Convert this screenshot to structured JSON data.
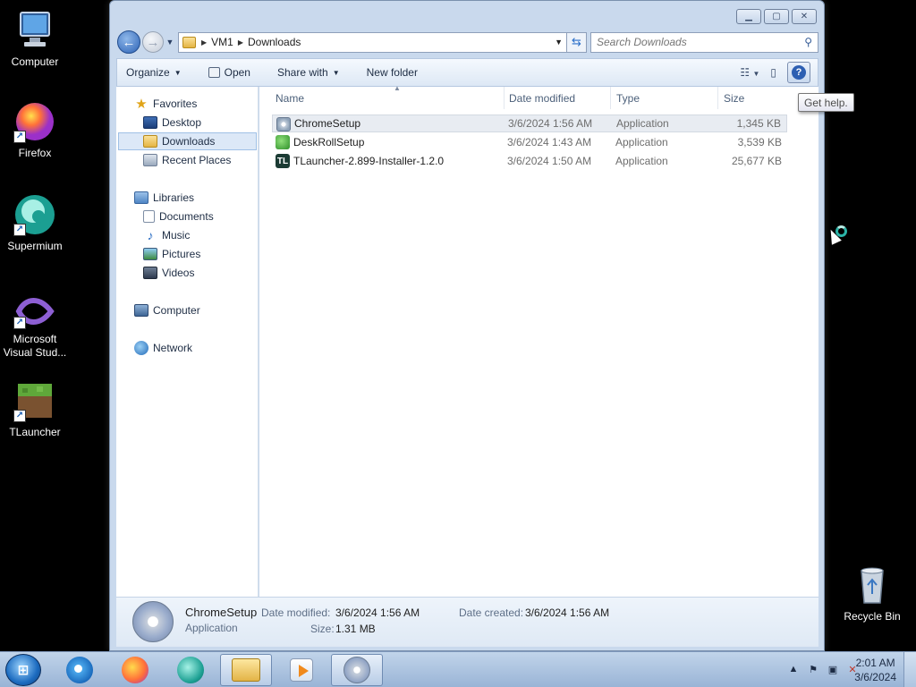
{
  "desktop": {
    "icons": [
      {
        "label": "Computer"
      },
      {
        "label": "Firefox"
      },
      {
        "label": "Supermium"
      },
      {
        "label": "Microsoft Visual Stud..."
      },
      {
        "label": "TLauncher"
      },
      {
        "label": "Recycle Bin"
      }
    ]
  },
  "window": {
    "address": {
      "crumbs": [
        "VM1",
        "Downloads"
      ]
    },
    "search": {
      "placeholder": "Search Downloads"
    },
    "toolbar": {
      "organize": "Organize",
      "open": "Open",
      "share_with": "Share with",
      "new_folder": "New folder"
    },
    "tooltip": "Get help.",
    "nav": {
      "favorites": "Favorites",
      "desktop": "Desktop",
      "downloads": "Downloads",
      "recent_places": "Recent Places",
      "libraries": "Libraries",
      "documents": "Documents",
      "music": "Music",
      "pictures": "Pictures",
      "videos": "Videos",
      "computer": "Computer",
      "network": "Network"
    },
    "columns": {
      "name": "Name",
      "date_modified": "Date modified",
      "type": "Type",
      "size": "Size"
    },
    "files": [
      {
        "name": "ChromeSetup",
        "date": "3/6/2024 1:56 AM",
        "type": "Application",
        "size": "1,345 KB"
      },
      {
        "name": "DeskRollSetup",
        "date": "3/6/2024 1:43 AM",
        "type": "Application",
        "size": "3,539 KB"
      },
      {
        "name": "TLauncher-2.899-Installer-1.2.0",
        "date": "3/6/2024 1:50 AM",
        "type": "Application",
        "size": "25,677 KB"
      }
    ],
    "details": {
      "name": "ChromeSetup",
      "type": "Application",
      "date_modified_label": "Date modified:",
      "date_modified": "3/6/2024 1:56 AM",
      "date_created_label": "Date created:",
      "date_created": "3/6/2024 1:56 AM",
      "size_label": "Size:",
      "size": "1.31 MB"
    }
  },
  "taskbar": {
    "time": "2:01 AM",
    "date": "3/6/2024"
  }
}
